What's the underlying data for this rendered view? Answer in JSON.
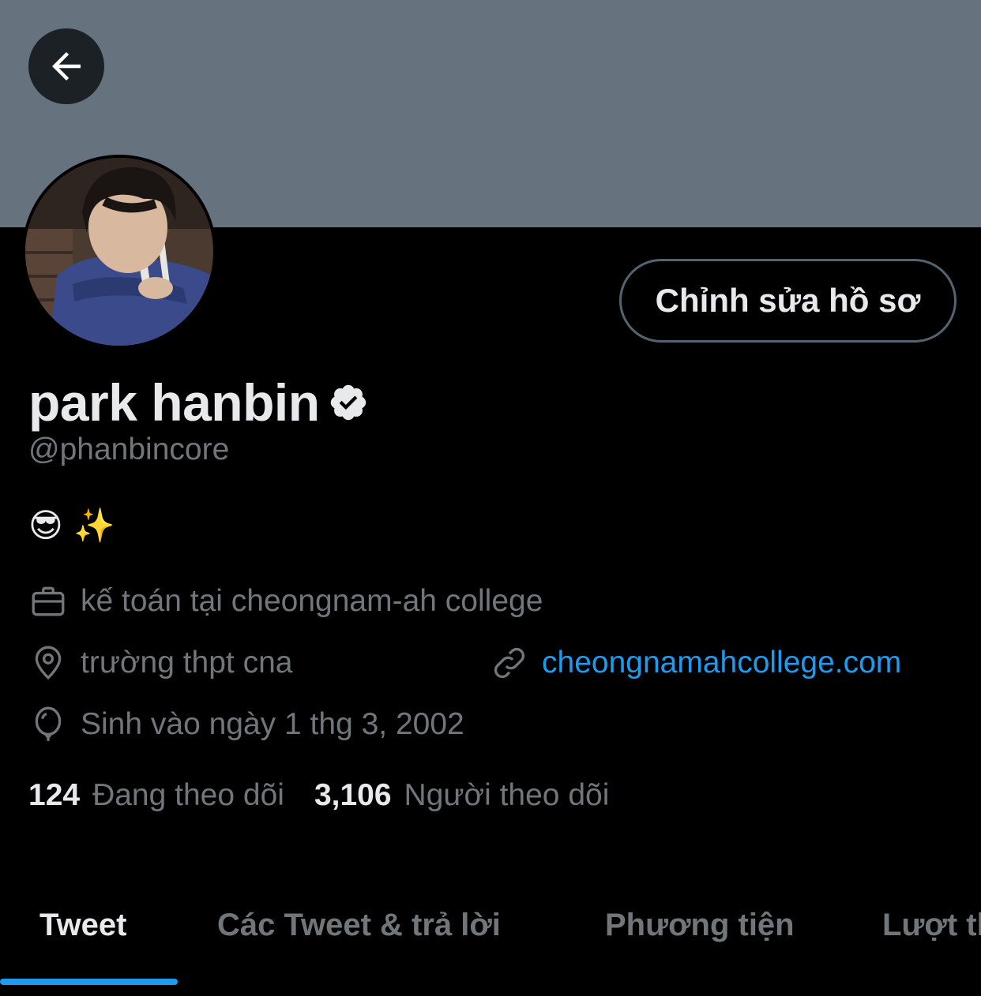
{
  "colors": {
    "banner": "#66737f",
    "accent": "#1d9bf0",
    "background": "#000000",
    "text_primary": "#e7e9ea",
    "text_secondary": "#71767b"
  },
  "header": {
    "back_icon": "arrow-left-icon"
  },
  "profile": {
    "edit_button_label": "Chỉnh sửa hồ sơ",
    "display_name": "park hanbin",
    "verified_icon": "verified-badge-icon",
    "handle": "@phanbincore",
    "bio": "😎 ✨",
    "work": {
      "icon": "briefcase-icon",
      "text": "kế toán tại cheongnam-ah college"
    },
    "location": {
      "icon": "location-pin-icon",
      "text": "trường thpt cna"
    },
    "website": {
      "icon": "link-icon",
      "text": "cheongnamahcollege.com"
    },
    "birthday": {
      "icon": "balloon-icon",
      "text": "Sinh vào ngày 1 thg 3, 2002"
    }
  },
  "stats": {
    "following": {
      "count": "124",
      "label": "Đang theo dõi"
    },
    "followers": {
      "count": "3,106",
      "label": "Người theo dõi"
    }
  },
  "tabs": [
    {
      "label": "Tweet",
      "active": true
    },
    {
      "label": "Các Tweet & trả lời",
      "active": false
    },
    {
      "label": "Phương tiện",
      "active": false
    },
    {
      "label": "Lượt thích",
      "active": false
    }
  ]
}
